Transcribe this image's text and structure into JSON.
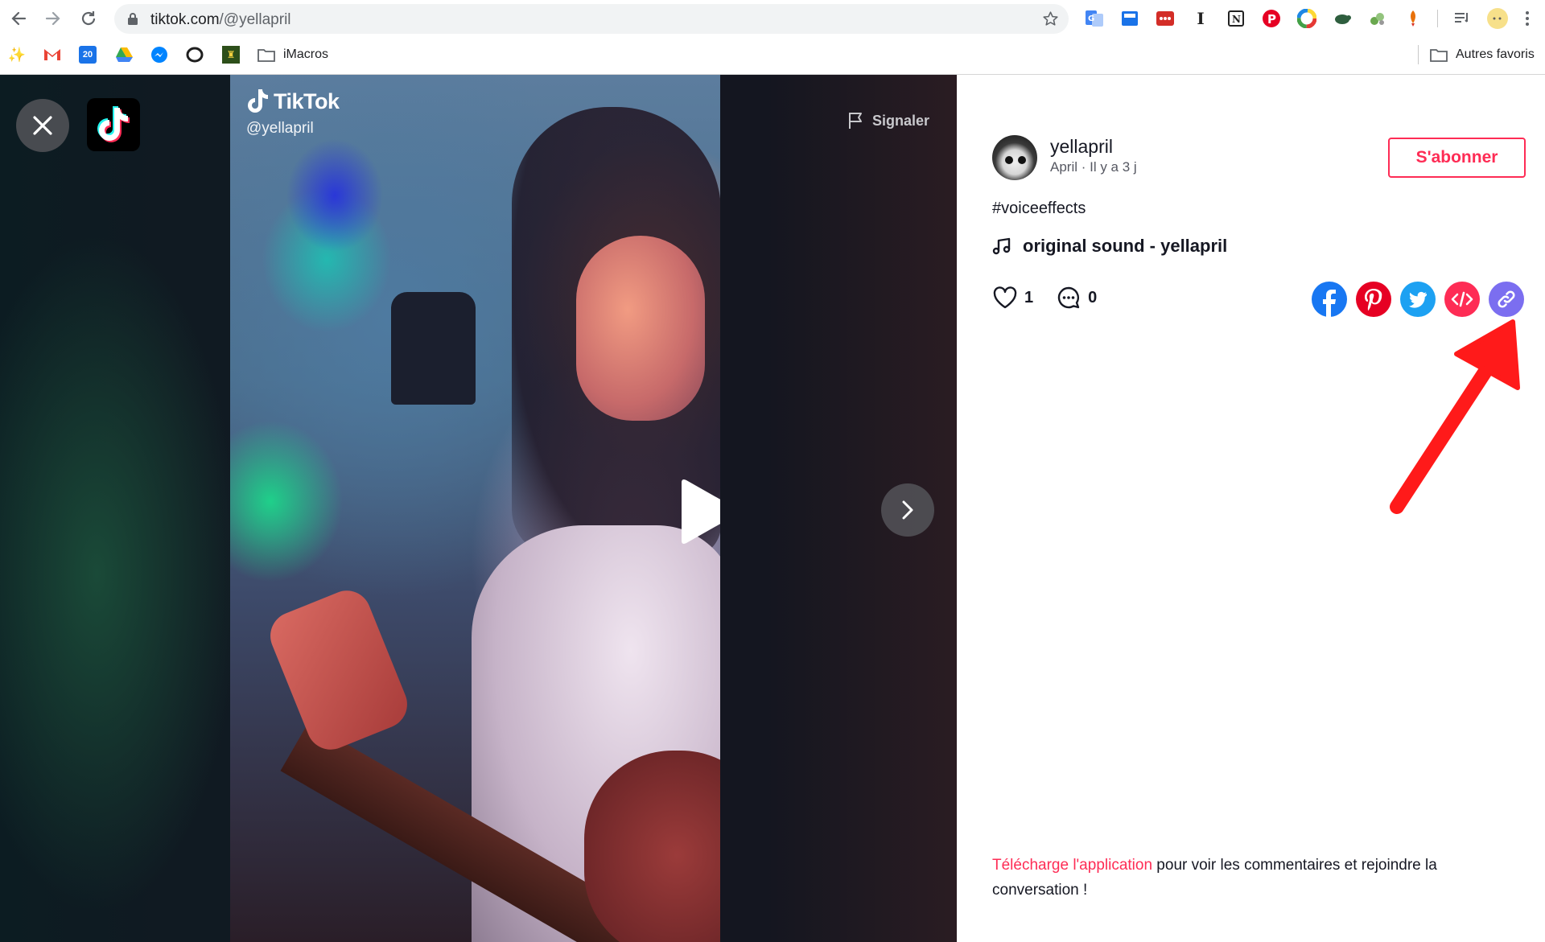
{
  "browser": {
    "url_domain": "tiktok.com",
    "url_path": "/@yellapril",
    "extensions": [
      "translate-icon",
      "screenshot-icon",
      "lastpass-icon",
      "instapaper-icon",
      "notion-icon",
      "pinterest-icon",
      "color-wheel-icon",
      "turtle-icon",
      "puzzle-icon",
      "rocket-icon"
    ],
    "bookmarks": [
      {
        "icon": "sparkle-icon",
        "label": ""
      },
      {
        "icon": "gmail-icon",
        "label": ""
      },
      {
        "icon": "calendar-icon",
        "label": "20"
      },
      {
        "icon": "drive-icon",
        "label": ""
      },
      {
        "icon": "messenger-icon",
        "label": ""
      },
      {
        "icon": "opera-icon",
        "label": ""
      },
      {
        "icon": "extension-icon",
        "label": ""
      },
      {
        "icon": "folder-icon",
        "label": "iMacros"
      }
    ],
    "other_bookmarks": "Autres favoris"
  },
  "video": {
    "watermark_brand": "TikTok",
    "watermark_handle": "@yellapril",
    "report_label": "Signaler"
  },
  "post": {
    "username": "yellapril",
    "meta": "April · Il y a 3 j",
    "follow_label": "S'abonner",
    "caption": "#voiceeffects",
    "music": "original sound - yellapril",
    "likes": "1",
    "comments": "0",
    "share": [
      {
        "name": "facebook-share-button",
        "color": "#1877f2"
      },
      {
        "name": "pinterest-share-button",
        "color": "#e60023"
      },
      {
        "name": "twitter-share-button",
        "color": "#1da1f2"
      },
      {
        "name": "embed-share-button",
        "color": "#fe2c55"
      },
      {
        "name": "copy-link-share-button",
        "color": "#7b6ef0"
      }
    ],
    "comment_link": "Télécharge l'application",
    "comment_rest": " pour voir les commentaires et rejoindre la conversation !"
  },
  "colors": {
    "accent": "#fe2c55",
    "annotation_arrow": "#ff1a1a"
  }
}
